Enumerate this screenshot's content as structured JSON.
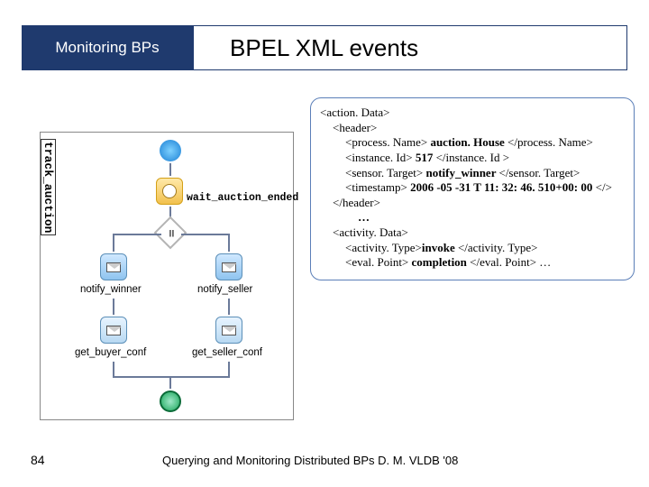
{
  "header": {
    "left": "Monitoring BPs",
    "right": "BPEL XML events"
  },
  "diagram": {
    "track_label": "track_auction",
    "wait_label": "wait_auction_ended",
    "notify_winner": "notify_winner",
    "notify_seller": "notify_seller",
    "get_buyer_conf": "get_buyer_conf",
    "get_seller_conf": "get_seller_conf",
    "parallel_symbol": "II"
  },
  "xml": {
    "l1": "<action. Data>",
    "l2": "<header>",
    "l3_open": "<process. Name>",
    "l3_val": " auction. House ",
    "l3_close": "</process. Name>",
    "l4_open": "<instance. Id>",
    "l4_val": " 517 ",
    "l4_close": "</instance. Id >",
    "l5_open": "<sensor. Target>",
    "l5_val": " notify_winner ",
    "l5_close": "</sensor. Target>",
    "l6_open": "<timestamp>",
    "l6_val": " 2006 -05 -31 T 11: 32: 46. 510+00: 00 ",
    "l6_close": "</>",
    "l7": "</header>",
    "l8": "…",
    "l9": "<activity. Data>",
    "l10_open": "<activity. Type>",
    "l10_val": "invoke ",
    "l10_close": "</activity. Type>",
    "l11_open": "<eval. Point>",
    "l11_val": " completion ",
    "l11_close": "</eval. Point> …"
  },
  "footer": {
    "page": "84",
    "text": "Querying and Monitoring Distributed BPs D. M. VLDB '08"
  }
}
